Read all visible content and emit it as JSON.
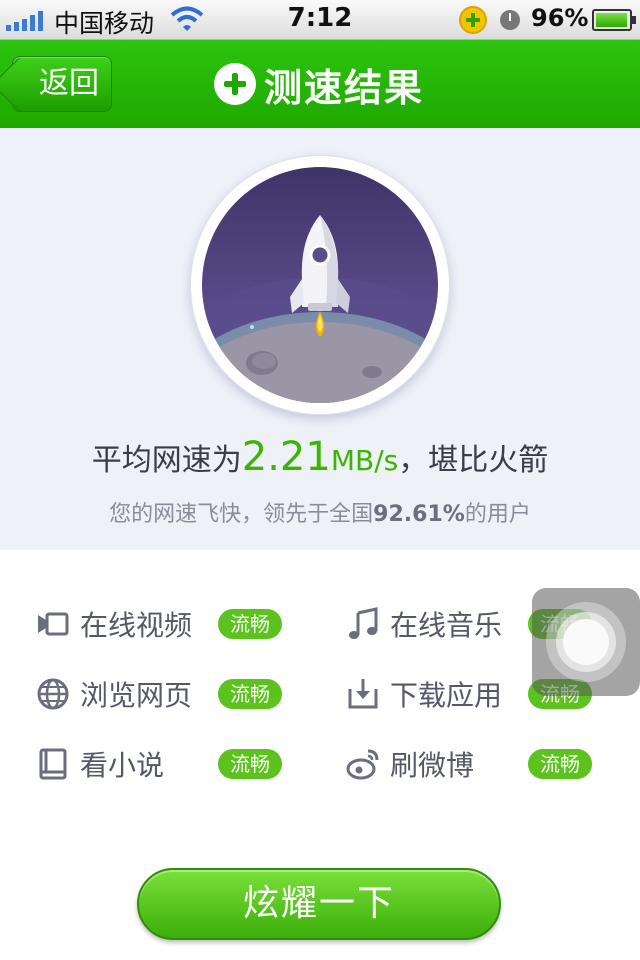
{
  "status_bar": {
    "carrier": "中国移动",
    "time": "7:12",
    "battery_percent": "96%",
    "battery_level": 0.96,
    "icons": [
      "signal-icon",
      "wifi-icon",
      "app-notification-icon",
      "clock-icon",
      "battery-icon"
    ]
  },
  "nav": {
    "back_label": "返回",
    "title": "测速结果",
    "accent": "#22b00a"
  },
  "result": {
    "avg_prefix": "平均网速为",
    "avg_value": "2.21",
    "avg_unit": "MB/s",
    "avg_suffix": "，堪比火箭",
    "sub_prefix": "您的网速飞快，领先于全国",
    "sub_percent": "92.61%",
    "sub_suffix": "的用户",
    "badge_icon": "rocket-moon-icon"
  },
  "items": [
    {
      "icon": "video-icon",
      "label": "在线视频",
      "status": "流畅"
    },
    {
      "icon": "music-icon",
      "label": "在线音乐",
      "status": "流畅"
    },
    {
      "icon": "globe-icon",
      "label": "浏览网页",
      "status": "流畅"
    },
    {
      "icon": "download-icon",
      "label": "下载应用",
      "status": "流畅"
    },
    {
      "icon": "book-icon",
      "label": "看小说",
      "status": "流畅"
    },
    {
      "icon": "weibo-icon",
      "label": "刷微博",
      "status": "流畅"
    }
  ],
  "status_color": "#5cc21e",
  "share_button": {
    "label": "炫耀一下"
  }
}
